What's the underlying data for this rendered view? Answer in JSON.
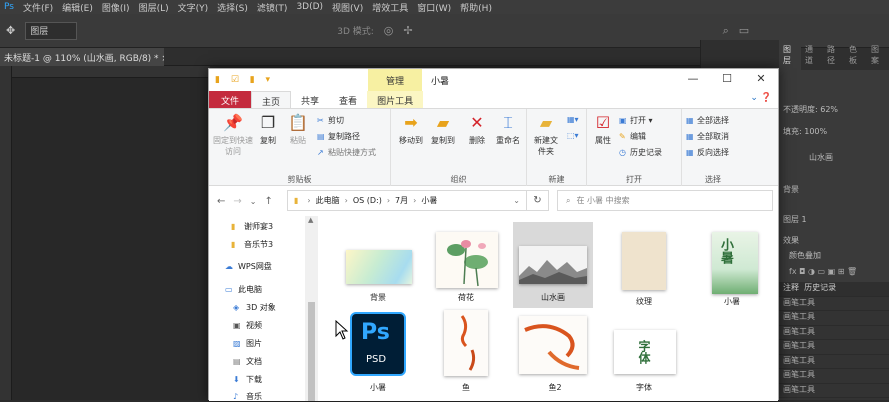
{
  "ps": {
    "menu": [
      "文件(F)",
      "编辑(E)",
      "图像(I)",
      "图层(L)",
      "文字(Y)",
      "选择(S)",
      "滤镜(T)",
      "3D(D)",
      "视图(V)",
      "增效工具",
      "窗口(W)",
      "帮助(H)"
    ],
    "layer_select": "图层",
    "mode_3d": "3D 模式:",
    "doc_tab": "未标题-1 @ 110% (山水画, RGB/8) *",
    "panel_tabs": [
      "图层",
      "通道",
      "路径",
      "色板",
      "图案"
    ],
    "opacity_label": "不透明度:",
    "opacity_value": "62%",
    "fill_label": "填充:",
    "fill_value": "100%",
    "layers": [
      "山水画",
      "背景",
      "图层 1",
      "效果",
      "颜色叠加"
    ],
    "history_tabs": [
      "注释",
      "历史记录"
    ],
    "history_items": [
      "画笔工具",
      "画笔工具",
      "画笔工具",
      "画笔工具",
      "画笔工具",
      "画笔工具",
      "画笔工具"
    ]
  },
  "explorer": {
    "title": "小暑",
    "manage": "管理",
    "window_controls": [
      "—",
      "☐",
      "✕"
    ],
    "ribbon_tabs": [
      "文件",
      "主页",
      "共享",
      "查看",
      "图片工具"
    ],
    "groups": {
      "clipboard": {
        "label": "剪贴板",
        "pin": "固定到快速访问",
        "copy": "复制",
        "paste": "粘贴",
        "cut": "剪切",
        "copy_path": "复制路径",
        "paste_shortcut": "粘贴快捷方式"
      },
      "organize": {
        "label": "组织",
        "move_to": "移动到",
        "copy_to": "复制到",
        "delete": "删除",
        "rename": "重命名"
      },
      "new": {
        "label": "新建",
        "new_folder": "新建文件夹"
      },
      "open": {
        "label": "打开",
        "properties": "属性",
        "open": "打开",
        "edit": "编辑",
        "history": "历史记录"
      },
      "select": {
        "label": "选择",
        "select_all": "全部选择",
        "select_none": "全部取消",
        "invert": "反向选择"
      }
    },
    "path": [
      "此电脑",
      "OS (D:)",
      "7月",
      "小暑"
    ],
    "search_placeholder": "在 小暑 中搜索",
    "nav_items": [
      "谢师宴3",
      "音乐节3",
      "WPS网盘",
      "此电脑",
      "3D 对象",
      "视频",
      "图片",
      "文档",
      "下载",
      "音乐"
    ],
    "files": [
      "背景",
      "荷花",
      "山水画",
      "纹理",
      "小暑",
      "小暑",
      "鱼",
      "鱼2",
      "字体"
    ],
    "psd_badge": "Ps",
    "psd_ext": "PSD",
    "thumb_text_1": "小暑",
    "thumb_text_2": "字体"
  }
}
